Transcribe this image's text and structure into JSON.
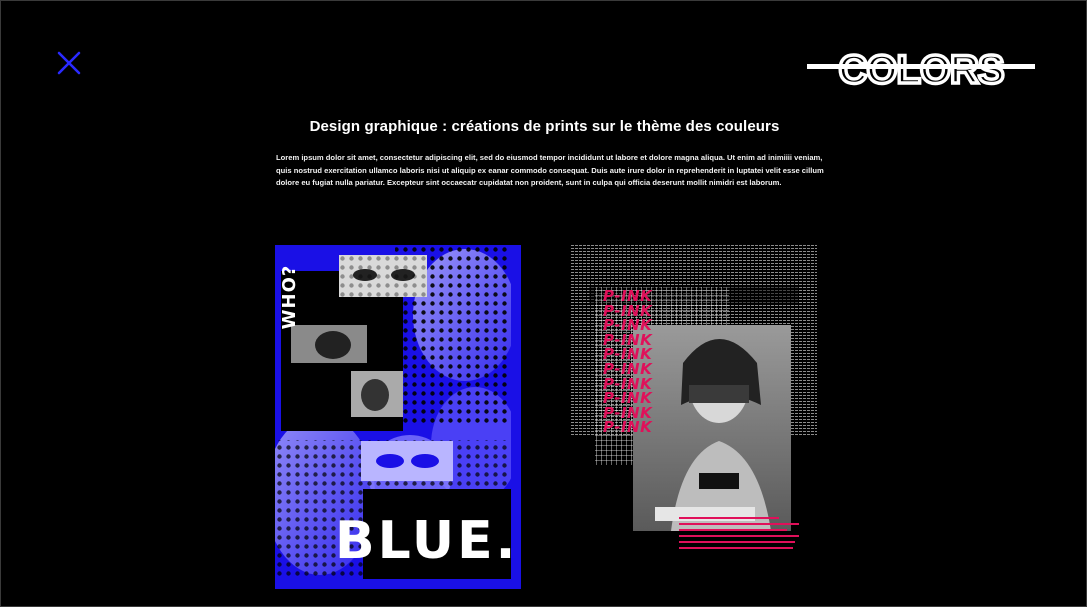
{
  "header": {
    "close_icon": "close-icon",
    "logo_text": "COLORS"
  },
  "content": {
    "title": "Design graphique : créations de prints sur le thème des couleurs",
    "description": "Lorem ipsum dolor sit amet, consectetur adipiscing elit, sed do eiusmod tempor incididunt ut labore et dolore magna aliqua. Ut enim ad inimiiii veniam, quis nostrud exercitation ullamco laboris nisi ut aliquip ex eanar commodo consequat. Duis aute irure dolor in reprehenderit in luptatei velit esse cillum dolore eu fugiat nulla pariatur. Excepteur sint occaecatr cupidatat non proident, sunt in culpa qui officia deserunt mollit nimidri est laborum."
  },
  "posters": {
    "blue": {
      "side_text": "WHO?",
      "big_text": "BLUE.",
      "accent_color": "#1a10e6"
    },
    "pink": {
      "repeat_text": "P-INK",
      "accent_color": "#e0105a"
    }
  },
  "colors": {
    "background": "#000000",
    "close_icon": "#2a2aff",
    "text": "#ffffff"
  }
}
